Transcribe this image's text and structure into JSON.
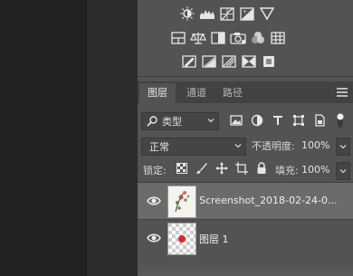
{
  "window": {
    "title": ""
  },
  "adjustments": {
    "row1": [
      "brightness-contrast-icon",
      "levels-icon",
      "curves-icon",
      "exposure-icon",
      "gradient-triangle-icon"
    ],
    "row2": [
      "vibrance-icon",
      "color-balance-icon",
      "photo-filter-icon",
      "camera-icon",
      "channel-mixer-icon",
      "color-lookup-icon"
    ],
    "row3": [
      "invert-icon",
      "posterize-icon",
      "threshold-icon",
      "gradient-map-icon",
      "selective-color-icon"
    ]
  },
  "tabs": [
    {
      "label": "图层",
      "active": true
    },
    {
      "label": "通道",
      "active": false
    },
    {
      "label": "路径",
      "active": false
    }
  ],
  "filter": {
    "label": "类型",
    "icon": "search-icon"
  },
  "blend": {
    "mode": "正常",
    "opacity_label": "不透明度:",
    "opacity_value": "100%"
  },
  "lock": {
    "label": "锁定:",
    "fill_label": "填充:",
    "fill_value": "100%"
  },
  "layers": [
    {
      "name": "Screenshot_2018-02-24-0...",
      "visible": true,
      "selected": true
    },
    {
      "name": "图层 1",
      "visible": true,
      "selected": false
    }
  ],
  "colors": {
    "panel": "#535353",
    "selected_row": "#6b6b6b",
    "dot": "#d92a2a"
  }
}
